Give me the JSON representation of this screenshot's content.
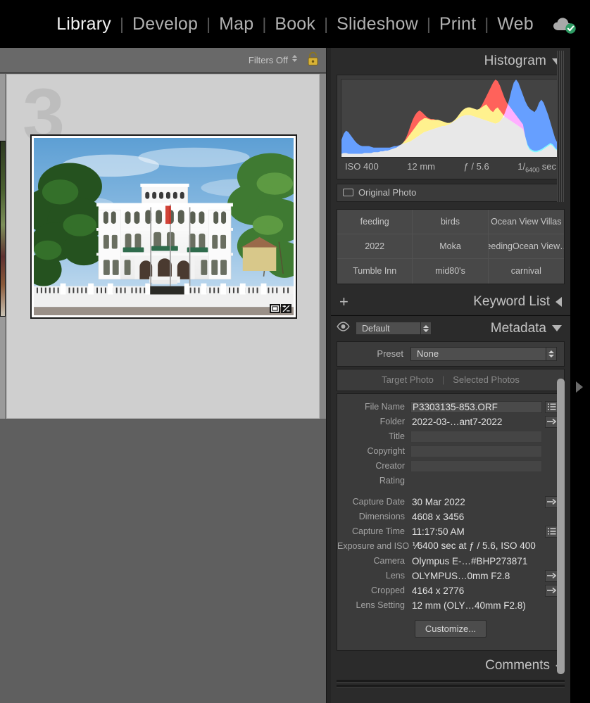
{
  "app": {
    "module_picker": [
      {
        "label": "Library",
        "active": true
      },
      {
        "label": "Develop",
        "active": false
      },
      {
        "label": "Map",
        "active": false
      },
      {
        "label": "Book",
        "active": false
      },
      {
        "label": "Slideshow",
        "active": false
      },
      {
        "label": "Print",
        "active": false
      },
      {
        "label": "Web",
        "active": false
      }
    ],
    "separator": "|",
    "cloud_sync_icon": "cloud-check-icon",
    "colors": {
      "topbar_bg": "#000000",
      "panel_bg": "#2b2b2b",
      "grid_bg": "#868686",
      "cell_bg": "#cfcfcf",
      "accent_green": "#2e9b63",
      "lock_gold": "#c8a13a"
    }
  },
  "filter_bar": {
    "label": "Filters Off",
    "stepper_icon": "stepper-icon",
    "lock_icon": "padlock-open-icon"
  },
  "grid": {
    "cell_index": "3",
    "badges": [
      {
        "name": "crop-badge-icon"
      },
      {
        "name": "develop-settings-badge-icon"
      }
    ],
    "photo_alt": "White colonial mansion with flagpoles behind a white fence"
  },
  "histogram": {
    "title": "Histogram",
    "collapse_icon": "triangle-down-icon",
    "iso": "ISO 400",
    "focal_length": "12 mm",
    "aperture": "ƒ / 5.6",
    "shutter_num": "1",
    "shutter_den": "6400",
    "shutter_unit": "sec",
    "original_photo_label": "Original Photo",
    "original_photo_icon": "rectangle-icon"
  },
  "chart_data": {
    "type": "area",
    "title": "Histogram",
    "xlabel": "",
    "ylabel": "",
    "xlim": [
      0,
      255
    ],
    "ylim": [
      0,
      100
    ],
    "grid": false,
    "legend": "none",
    "series": [
      {
        "name": "Red",
        "color": "#ff3b30",
        "values": [
          4,
          5,
          5,
          4,
          4,
          4,
          4,
          4,
          4,
          4,
          5,
          5,
          5,
          5,
          6,
          6,
          6,
          7,
          7,
          8,
          8,
          9,
          10,
          11,
          12,
          14,
          16,
          19,
          24,
          31,
          40,
          48,
          54,
          58,
          60,
          58,
          55,
          52,
          50,
          49,
          49,
          48,
          48,
          47,
          46,
          45,
          44,
          44,
          45,
          47,
          50,
          54,
          58,
          61,
          63,
          64,
          64,
          63,
          62,
          61,
          62,
          66,
          72,
          78,
          84,
          90,
          96,
          100,
          98,
          92,
          84,
          76,
          70,
          66,
          62,
          58,
          54,
          50,
          46,
          42,
          26,
          14,
          9,
          7,
          6,
          6,
          7,
          8,
          10,
          12,
          14,
          16,
          14,
          10,
          8,
          14
        ]
      },
      {
        "name": "Green",
        "color": "#3ddc5a",
        "values": [
          4,
          5,
          5,
          4,
          4,
          4,
          4,
          4,
          4,
          4,
          5,
          5,
          5,
          5,
          6,
          6,
          6,
          7,
          7,
          8,
          8,
          9,
          10,
          11,
          12,
          14,
          16,
          19,
          22,
          26,
          30,
          34,
          38,
          42,
          46,
          48,
          50,
          50,
          49,
          48,
          48,
          48,
          48,
          47,
          46,
          45,
          44,
          44,
          45,
          47,
          50,
          54,
          58,
          61,
          63,
          64,
          64,
          63,
          62,
          61,
          62,
          64,
          66,
          68,
          64,
          60,
          58,
          62,
          64,
          60,
          56,
          52,
          50,
          48,
          46,
          44,
          42,
          40,
          38,
          36,
          26,
          16,
          11,
          9,
          8,
          8,
          9,
          10,
          12,
          14,
          16,
          18,
          16,
          12,
          9,
          14
        ]
      },
      {
        "name": "Blue",
        "color": "#4a90ff",
        "values": [
          22,
          30,
          34,
          32,
          28,
          24,
          20,
          17,
          15,
          14,
          14,
          14,
          14,
          13,
          12,
          12,
          12,
          12,
          12,
          12,
          12,
          12,
          13,
          14,
          14,
          15,
          16,
          17,
          18,
          19,
          20,
          22,
          24,
          26,
          28,
          30,
          32,
          33,
          34,
          35,
          36,
          37,
          38,
          39,
          40,
          40,
          41,
          42,
          44,
          46,
          48,
          50,
          52,
          53,
          54,
          54,
          54,
          53,
          52,
          51,
          50,
          49,
          48,
          47,
          46,
          45,
          44,
          43,
          44,
          46,
          50,
          56,
          64,
          74,
          86,
          96,
          100,
          96,
          88,
          80,
          72,
          66,
          62,
          60,
          58,
          62,
          70,
          74,
          70,
          62,
          54,
          44,
          34,
          24,
          18,
          14
        ]
      },
      {
        "name": "Luminance",
        "color": "#e6e6e6",
        "values": [
          4,
          5,
          5,
          4,
          4,
          4,
          4,
          4,
          4,
          4,
          5,
          5,
          5,
          5,
          6,
          6,
          6,
          7,
          7,
          8,
          8,
          9,
          10,
          11,
          12,
          13,
          14,
          15,
          16,
          17,
          18,
          19,
          20,
          22,
          24,
          26,
          28,
          29,
          30,
          31,
          32,
          33,
          34,
          35,
          36,
          37,
          38,
          39,
          40,
          42,
          44,
          46,
          48,
          50,
          51,
          52,
          52,
          52,
          51,
          50,
          50,
          50,
          50,
          50,
          50,
          50,
          50,
          50,
          51,
          52,
          53,
          54,
          56,
          58,
          60,
          62,
          64,
          66,
          68,
          70,
          64,
          56,
          50,
          48,
          46,
          44,
          42,
          40,
          38,
          36,
          32,
          26,
          20,
          14,
          10,
          8
        ]
      }
    ]
  },
  "keyword_suggestions": {
    "items": [
      "feeding",
      "birds",
      "Ocean View Villas",
      "2022",
      "Moka",
      "feedingOcean View…",
      "Tumble Inn",
      "mid80's",
      "carnival"
    ]
  },
  "keyword_list": {
    "title": "Keyword List",
    "add_icon": "plus-icon",
    "collapse_icon": "triangle-left-icon"
  },
  "metadata": {
    "title": "Metadata",
    "eye_icon": "eye-icon",
    "view_preset": "Default",
    "collapse_icon": "triangle-down-icon",
    "preset_label": "Preset",
    "preset_value": "None",
    "target_photo": "Target Photo",
    "selected_photos": "Selected Photos",
    "fields": [
      {
        "label": "File Name",
        "value": "P3303135-853.ORF",
        "style": "boxed",
        "action": "list-icon"
      },
      {
        "label": "Folder",
        "value": "2022-03-…ant7-2022",
        "style": "plain",
        "action": "arrow-icon"
      },
      {
        "label": "Title",
        "value": "",
        "style": "empty",
        "action": "none"
      },
      {
        "label": "Copyright",
        "value": "",
        "style": "empty",
        "action": "none"
      },
      {
        "label": "Creator",
        "value": "",
        "style": "empty",
        "action": "none"
      },
      {
        "label": "Rating",
        "value": "",
        "style": "plain",
        "action": "none"
      },
      {
        "label": "Capture Date",
        "value": "30 Mar 2022",
        "style": "plain",
        "action": "arrow-icon"
      },
      {
        "label": "Dimensions",
        "value": "4608 x 3456",
        "style": "plain",
        "action": "none"
      },
      {
        "label": "Capture Time",
        "value": "11:17:50 AM",
        "style": "plain",
        "action": "list-icon"
      },
      {
        "label": "Exposure and ISO",
        "value": "⅟6400 sec at ƒ / 5.6, ISO 400",
        "style": "plain",
        "action": "none"
      },
      {
        "label": "Camera",
        "value": "Olympus E-…#BHP273871",
        "style": "plain",
        "action": "none"
      },
      {
        "label": "Lens",
        "value": "OLYMPUS…0mm F2.8",
        "style": "plain",
        "action": "arrow-icon"
      },
      {
        "label": "Cropped",
        "value": "4164 x 2776",
        "style": "plain",
        "action": "arrow-icon"
      },
      {
        "label": "Lens Setting",
        "value": "12 mm (OLY…40mm F2.8)",
        "style": "plain",
        "action": "none"
      }
    ],
    "customize_button": "Customize..."
  },
  "comments": {
    "title": "Comments",
    "collapse_icon": "triangle-left-icon"
  }
}
